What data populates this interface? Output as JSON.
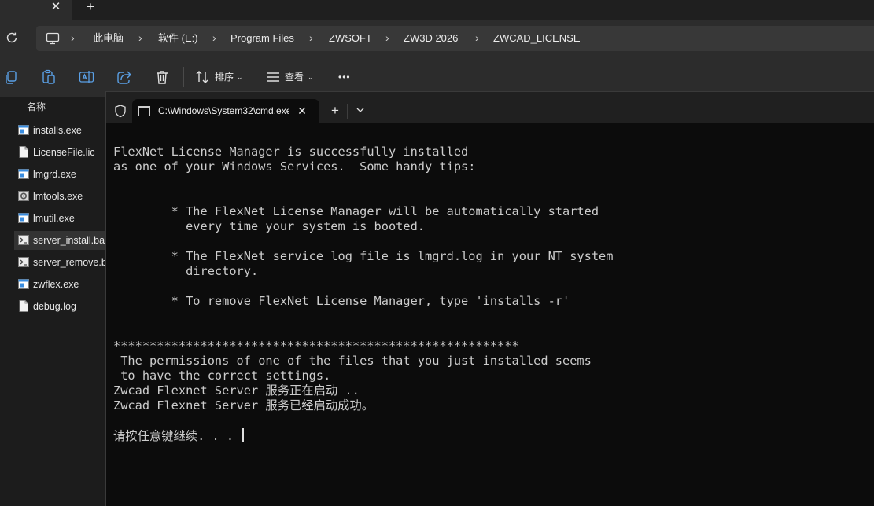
{
  "explorer": {
    "tab_close": "✕",
    "tab_new": "+",
    "breadcrumb": [
      "此电脑",
      "软件 (E:)",
      "Program Files",
      "ZWSOFT",
      "ZW3D 2026",
      "ZWCAD_LICENSE"
    ],
    "commands": {
      "sort_label": "排序",
      "view_label": "查看",
      "more_label": "•••"
    },
    "column_header": "名称",
    "files": [
      {
        "name": "installs.exe",
        "icon": "exe-icon"
      },
      {
        "name": "LicenseFile.lic",
        "icon": "file-icon"
      },
      {
        "name": "lmgrd.exe",
        "icon": "exe-icon"
      },
      {
        "name": "lmtools.exe",
        "icon": "tools-exe-icon"
      },
      {
        "name": "lmutil.exe",
        "icon": "exe-icon"
      },
      {
        "name": "server_install.bat",
        "icon": "batch-file-icon",
        "selected": true
      },
      {
        "name": "server_remove.bat",
        "icon": "batch-file-icon"
      },
      {
        "name": "zwflex.exe",
        "icon": "exe-icon"
      },
      {
        "name": "debug.log",
        "icon": "file-icon"
      }
    ]
  },
  "terminal": {
    "tab_title": "C:\\Windows\\System32\\cmd.exe",
    "tab_close": "✕",
    "new_tab": "+",
    "lines": [
      "FlexNet License Manager is successfully installed",
      "as one of your Windows Services.  Some handy tips:",
      "",
      "",
      "        * The FlexNet License Manager will be automatically started",
      "          every time your system is booted.",
      "",
      "        * The FlexNet service log file is lmgrd.log in your NT system",
      "          directory.",
      "",
      "        * To remove FlexNet License Manager, type 'installs -r'",
      "",
      "",
      "********************************************************",
      " The permissions of one of the files that you just installed seems",
      " to have the correct settings.",
      "Zwcad Flexnet Server 服务正在启动 ..",
      "Zwcad Flexnet Server 服务已经启动成功。",
      "",
      "请按任意键继续. . . "
    ]
  },
  "colors": {
    "explorer_bg": "#1c1c1c",
    "toolbar_bg": "#2c2c2c",
    "terminal_bg": "#0c0c0c",
    "terminal_text": "#cccccc",
    "exe_icon_blue": "#3a8de0"
  }
}
